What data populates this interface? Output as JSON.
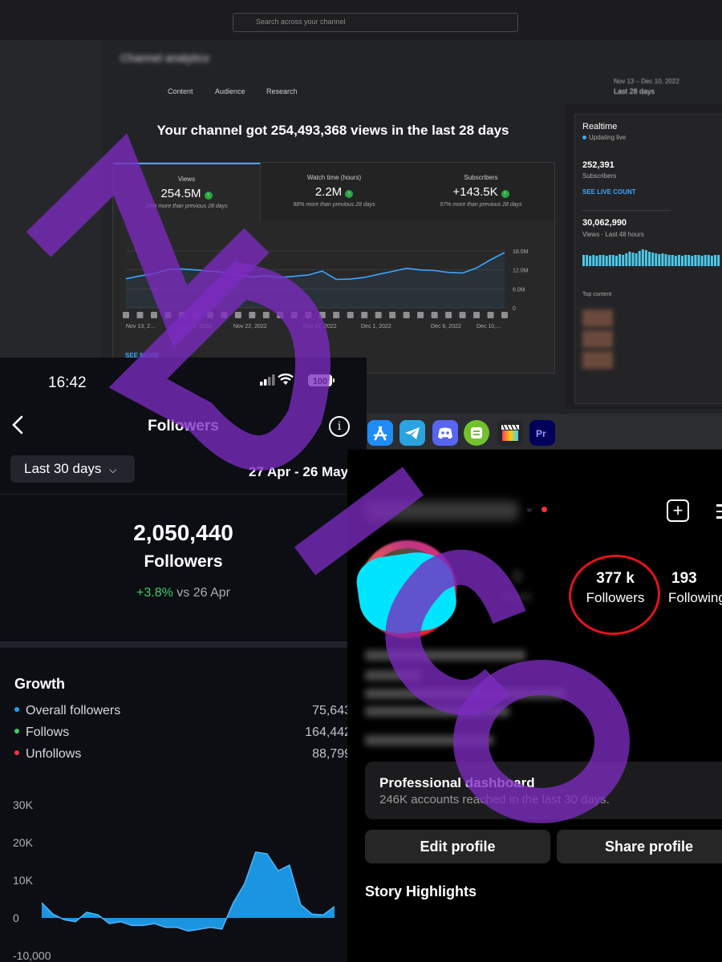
{
  "youtube": {
    "search_placeholder": "Search across your channel",
    "page_title": "Channel analytics",
    "tabs": [
      "Content",
      "Audience",
      "Research"
    ],
    "date_range": {
      "top": "Nov 13 – Dec 10, 2022",
      "label": "Last 28 days"
    },
    "headline": "Your channel got 254,493,368 views in the last 28 days",
    "metrics": [
      {
        "label": "Views",
        "value": "254.5M",
        "comparison": "99% more than previous 28 days"
      },
      {
        "label": "Watch time (hours)",
        "value": "2.2M",
        "comparison": "98% more than previous 28 days"
      },
      {
        "label": "Subscribers",
        "value": "+143.5K",
        "comparison": "97% more than previous 28 days"
      }
    ],
    "see_more": "SEE MORE",
    "realtime": {
      "title": "Realtime",
      "status": "Updating live",
      "subscribers_value": "252,391",
      "subscribers_label": "Subscribers",
      "cta": "SEE LIVE COUNT",
      "views_value": "30,062,990",
      "views_label": "Views · Last 48 hours",
      "top_content": "Top content"
    },
    "chart_data": {
      "type": "line",
      "title": "",
      "ylabel": "",
      "xlabel": "",
      "x_ticks": [
        "Nov 13, 2…",
        "Nov 18, 2022",
        "Nov 22, 2022",
        "Nov 27, 2022",
        "Dec 1, 2022",
        "Dec 6, 2022",
        "Dec 10,…"
      ],
      "y_ticks": [
        "0",
        "6.0M",
        "12.0M",
        "18.0M"
      ],
      "ylim": [
        0,
        18000000
      ],
      "series": [
        {
          "values": [
            9.2,
            10.1,
            10.8,
            12.1,
            12.3,
            12.0,
            11.6,
            11.2,
            10.3,
            9.8,
            10.1,
            9.6,
            10.0,
            10.4,
            11.6,
            9.0,
            9.1,
            9.6,
            10.6,
            11.5,
            12.5,
            12.0,
            11.8,
            11.2,
            11.0,
            12.6,
            15.2,
            17.5
          ],
          "unit": "millions of views"
        }
      ],
      "grid": true
    }
  },
  "dock": {
    "icons": [
      "app-store",
      "telegram",
      "discord",
      "cloud-app",
      "final-cut",
      "premiere"
    ]
  },
  "phone": {
    "time": "16:42",
    "battery": "100",
    "title": "Followers",
    "range_button": "Last 30 days",
    "dates": "27 Apr - 26 May",
    "total": "2,050,440",
    "total_label": "Followers",
    "change_value": "+3.8%",
    "change_suffix": "vs 26 Apr",
    "growth_title": "Growth",
    "growth_rows": [
      {
        "label": "Overall followers",
        "value": "75,643",
        "color": "#1da1f2"
      },
      {
        "label": "Follows",
        "value": "164,442",
        "color": "#3ccf6b"
      },
      {
        "label": "Unfollows",
        "value": "88,799",
        "color": "#f0364b"
      }
    ],
    "chart_data": {
      "type": "area",
      "title": "",
      "y_ticks": [
        "30K",
        "20K",
        "10K",
        "0",
        "-10,000"
      ],
      "ylim": [
        -10000,
        30000
      ],
      "series": [
        {
          "values": [
            4000,
            1000,
            -500,
            -1000,
            1500,
            800,
            -1500,
            -1000,
            -2000,
            -2000,
            -1500,
            -2500,
            -2500,
            -3500,
            -3000,
            -2500,
            -3000,
            4000,
            9000,
            17500,
            17000,
            12500,
            14000,
            3500,
            1000,
            800,
            3000
          ],
          "color": "#1da1f2"
        }
      ]
    }
  },
  "instagram": {
    "followers_count": "377 k",
    "followers_label": "Followers",
    "following_count": "193",
    "following_label": "Following",
    "dashboard_title": "Professional dashboard",
    "dashboard_subtitle": "246K accounts reached in the last 30 days.",
    "edit_button": "Edit profile",
    "share_button": "Share profile",
    "highlights": "Story Highlights"
  },
  "watermark": {
    "text": "NDICO",
    "color": "#7b2cbf"
  }
}
